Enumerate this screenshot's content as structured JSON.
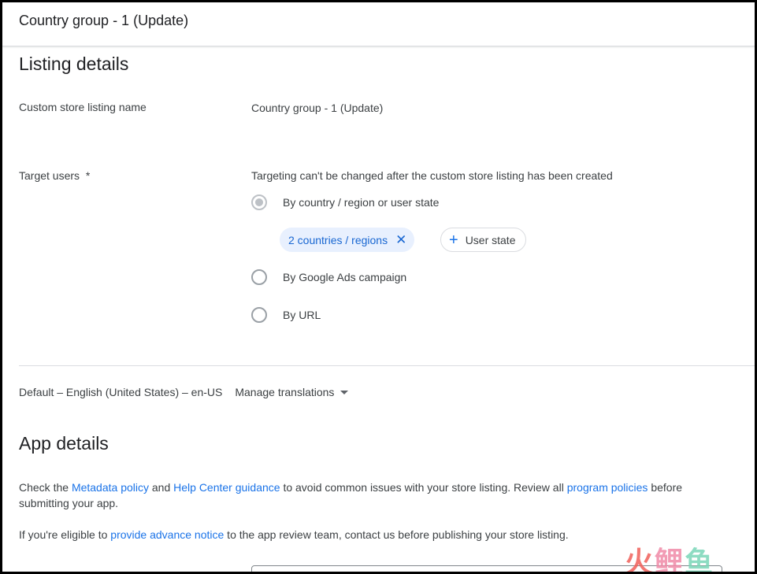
{
  "header": {
    "title": "Country group - 1 (Update)"
  },
  "listing_details": {
    "heading": "Listing details",
    "name_label": "Custom store listing name",
    "name_value": "Country group - 1 (Update)",
    "target_label": "Target users  *",
    "target_note": "Targeting can't be changed after the custom store listing has been created",
    "options": [
      {
        "label": "By country / region or user state",
        "checked": true
      },
      {
        "label": "By Google Ads campaign",
        "checked": false
      },
      {
        "label": "By URL",
        "checked": false
      }
    ],
    "chip_selected": "2 countries / regions",
    "chip_add": "User state"
  },
  "language": {
    "default": "Default – English (United States) – en-US",
    "manage": "Manage translations"
  },
  "app_details": {
    "heading": "App details",
    "para1": {
      "t1": "Check the ",
      "link1": "Metadata policy",
      "t2": " and ",
      "link2": "Help Center guidance",
      "t3": " to avoid common issues with your store listing. Review all ",
      "link3": "program policies",
      "t4": " before submitting your app."
    },
    "para2": {
      "t1": "If you're eligible to ",
      "link1": "provide advance notice",
      "t2": " to the app review team, contact us before publishing your store listing."
    }
  },
  "watermark": {
    "c1": "火",
    "c2": "鲤",
    "c3": "鱼"
  },
  "colors": {
    "link": "#1a73e8",
    "chip_bg": "#e8f0fe",
    "chip_text": "#1967d2"
  }
}
